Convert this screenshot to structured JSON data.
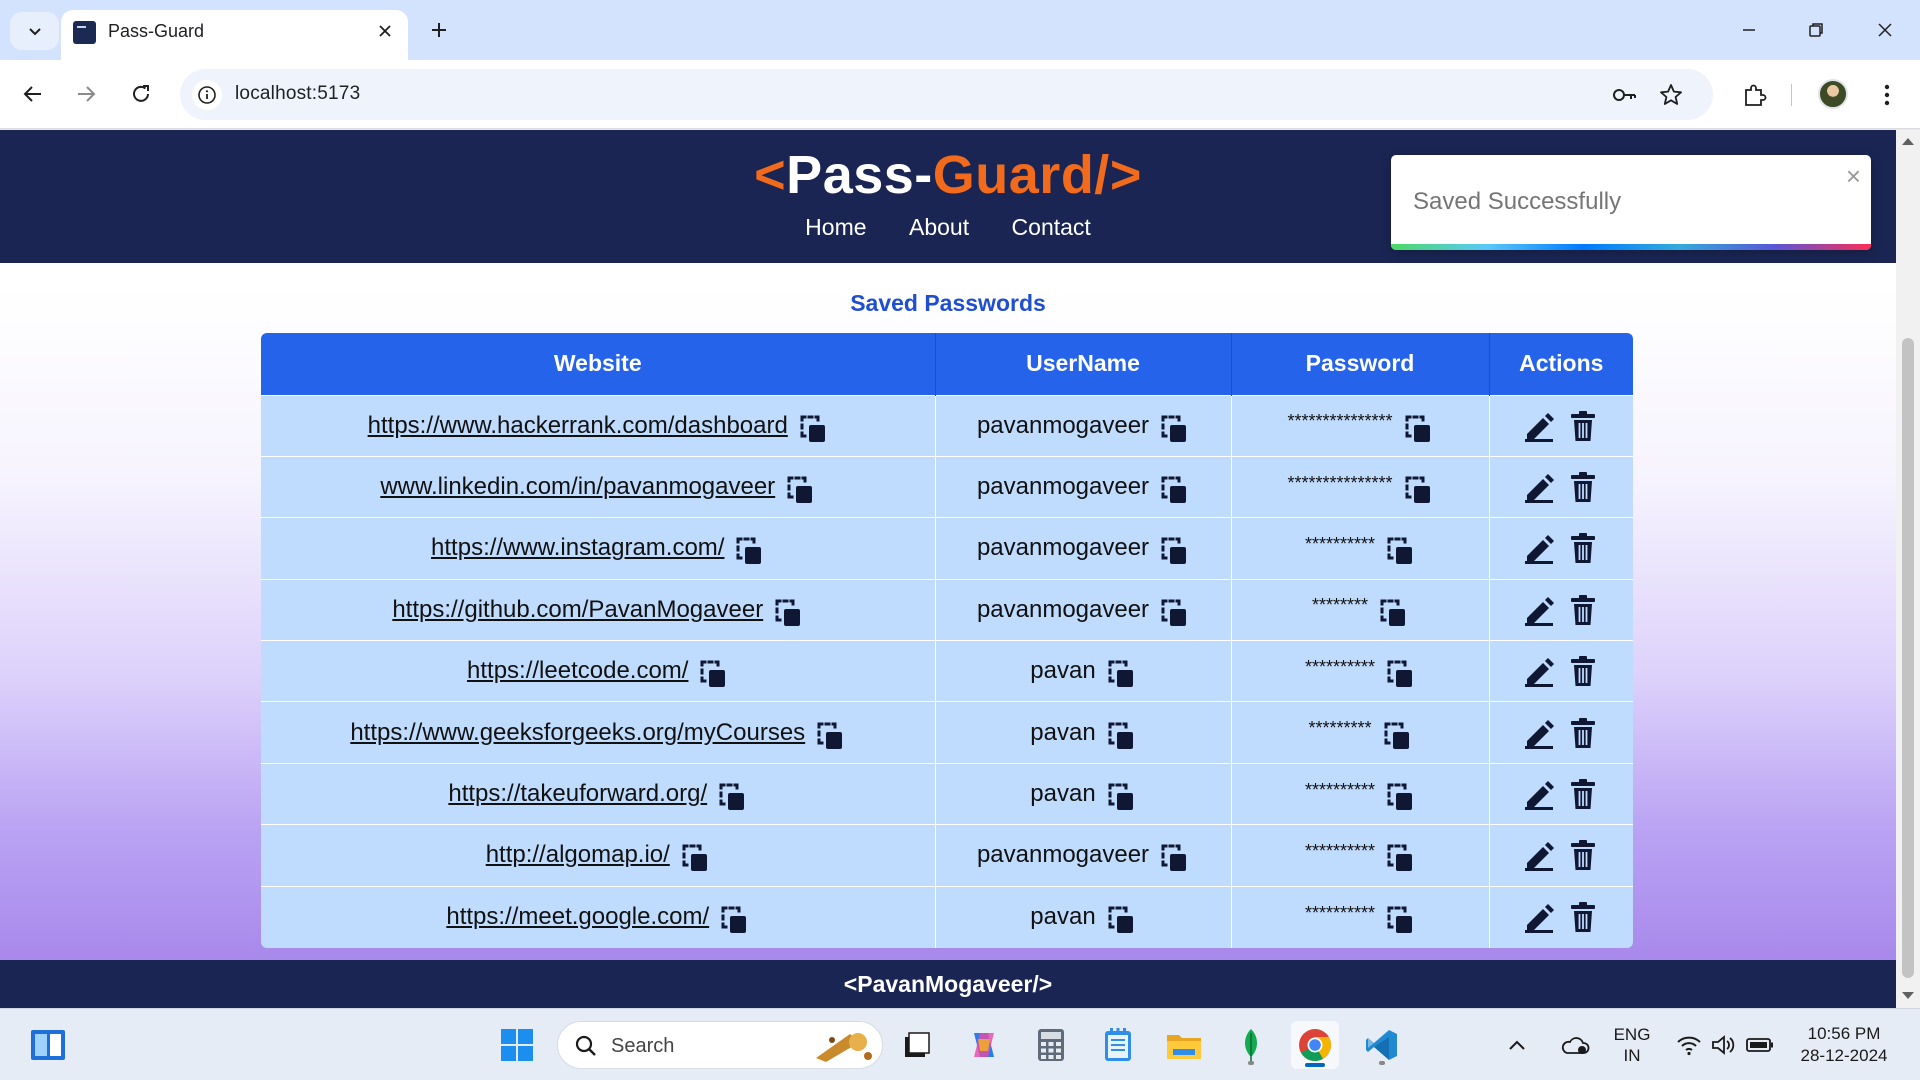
{
  "browser": {
    "tab_title": "Pass-Guard",
    "url": "localhost:5173"
  },
  "site": {
    "logo_open": "<",
    "logo_pass": "Pass-",
    "logo_guard": "Guard/",
    "logo_close": ">",
    "nav": [
      "Home",
      "About",
      "Contact"
    ],
    "toast_message": "Saved Successfully",
    "toast_close": "×",
    "section_title": "Saved Passwords",
    "table_headers": [
      "Website",
      "UserName",
      "Password",
      "Actions"
    ],
    "rows": [
      {
        "website": "https://www.hackerrank.com/dashboard",
        "username": "pavanmogaveer",
        "password": "***************"
      },
      {
        "website": "www.linkedin.com/in/pavanmogaveer",
        "username": "pavanmogaveer",
        "password": "***************"
      },
      {
        "website": "https://www.instagram.com/",
        "username": "pavanmogaveer",
        "password": "**********"
      },
      {
        "website": "https://github.com/PavanMogaveer",
        "username": "pavanmogaveer",
        "password": "********"
      },
      {
        "website": "https://leetcode.com/",
        "username": "pavan",
        "password": "**********"
      },
      {
        "website": "https://www.geeksforgeeks.org/myCourses",
        "username": "pavan",
        "password": "*********"
      },
      {
        "website": "https://takeuforward.org/",
        "username": "pavan",
        "password": "**********"
      },
      {
        "website": "http://algomap.io/",
        "username": "pavanmogaveer",
        "password": "**********"
      },
      {
        "website": "https://meet.google.com/",
        "username": "pavan",
        "password": "**********"
      }
    ],
    "footer": "<PavanMogaveer/>"
  },
  "taskbar": {
    "search_placeholder": "Search",
    "lang_line1": "ENG",
    "lang_line2": "IN",
    "time": "10:56 PM",
    "date": "28-12-2024"
  },
  "colors": {
    "header_bg": "#1a2553",
    "accent_orange": "#f26a1b",
    "table_header": "#2563eb",
    "table_row": "#bfdbfe",
    "title_blue": "#1f4ed1"
  }
}
